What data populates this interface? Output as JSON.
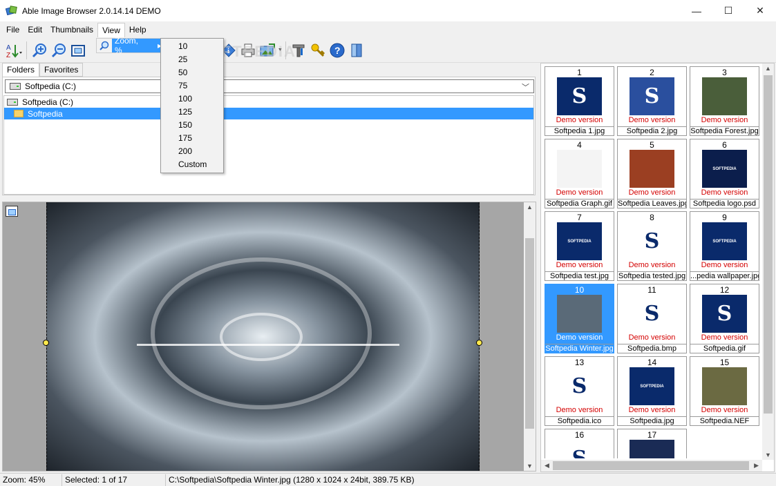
{
  "window": {
    "title": "Able Image Browser 2.0.14.14 DEMO",
    "minimize": "—",
    "maximize": "☐",
    "close": "✕"
  },
  "menu": {
    "file": "File",
    "edit": "Edit",
    "thumbnails": "Thumbnails",
    "view": "View",
    "help": "Help"
  },
  "view_menu": {
    "zoom_item": "Zoom, %",
    "zoom_arrow": "▸",
    "zoom_options": [
      "10",
      "25",
      "50",
      "75",
      "100",
      "125",
      "150",
      "175",
      "200",
      "Custom"
    ]
  },
  "watermark": "SOFTPEDIA",
  "left_panel": {
    "tabs": [
      "Folders",
      "Favorites"
    ],
    "drive_select_value": "Softpedia (C:)",
    "tree": [
      {
        "label": "Softpedia (C:)",
        "selected": false
      },
      {
        "label": "Softpedia",
        "selected": true
      }
    ]
  },
  "thumbnails": [
    {
      "num": "1",
      "demo": "Demo version",
      "name": "Softpedia 1.jpg",
      "art": "S",
      "bg": "#0a2a6b",
      "selected": false
    },
    {
      "num": "2",
      "demo": "Demo version",
      "name": "Softpedia 2.jpg",
      "art": "S",
      "bg": "#2a4f9e",
      "selected": false
    },
    {
      "num": "3",
      "demo": "Demo version",
      "name": "Softpedia Forest.jpg",
      "art": "",
      "bg": "#4a5e3a",
      "selected": false
    },
    {
      "num": "4",
      "demo": "Demo version",
      "name": "Softpedia Graph.gif",
      "art": "",
      "bg": "#f4f4f4",
      "selected": false
    },
    {
      "num": "5",
      "demo": "Demo version",
      "name": "Softpedia Leaves.jpg",
      "art": "",
      "bg": "#9b3f22",
      "selected": false
    },
    {
      "num": "6",
      "demo": "Demo version",
      "name": "Softpedia logo.psd",
      "art": "SOFTPEDIA",
      "bg": "#0b1e4c",
      "selected": false
    },
    {
      "num": "7",
      "demo": "Demo version",
      "name": "Softpedia test.jpg",
      "art": "SOFTPEDIA",
      "bg": "#0a2a6b",
      "selected": false
    },
    {
      "num": "8",
      "demo": "Demo version",
      "name": "Softpedia tested.jpg",
      "art": "S",
      "bg": "#ffffff",
      "selected": false
    },
    {
      "num": "9",
      "demo": "Demo version",
      "name": "...pedia wallpaper.jpg",
      "art": "SOFTPEDIA",
      "bg": "#0a2a6b",
      "selected": false
    },
    {
      "num": "10",
      "demo": "Demo version",
      "name": "Softpedia Winter.jpg",
      "art": "",
      "bg": "#5a6a78",
      "selected": true
    },
    {
      "num": "11",
      "demo": "Demo version",
      "name": "Softpedia.bmp",
      "art": "S",
      "bg": "#ffffff",
      "selected": false
    },
    {
      "num": "12",
      "demo": "Demo version",
      "name": "Softpedia.gif",
      "art": "S",
      "bg": "#0a2a6b",
      "selected": false
    },
    {
      "num": "13",
      "demo": "Demo version",
      "name": "Softpedia.ico",
      "art": "S",
      "bg": "#ffffff",
      "selected": false
    },
    {
      "num": "14",
      "demo": "Demo version",
      "name": "Softpedia.jpg",
      "art": "SOFTPEDIA",
      "bg": "#0a2a6b",
      "selected": false
    },
    {
      "num": "15",
      "demo": "Demo version",
      "name": "Softpedia.NEF",
      "art": "",
      "bg": "#6b6a42",
      "selected": false
    },
    {
      "num": "16",
      "demo": "",
      "name": "",
      "art": "S",
      "bg": "#ffffff",
      "selected": false
    },
    {
      "num": "17",
      "demo": "",
      "name": "",
      "art": "",
      "bg": "#1a2b55",
      "selected": false
    }
  ],
  "status": {
    "zoom": "Zoom: 45%",
    "selected": "Selected: 1 of 17",
    "file_info": "C:\\Softpedia\\Softpedia Winter.jpg (1280 x 1024 x 24bit, 389.75 KB)"
  },
  "colors": {
    "selection": "#3399ff",
    "demo_text": "#d40000"
  }
}
